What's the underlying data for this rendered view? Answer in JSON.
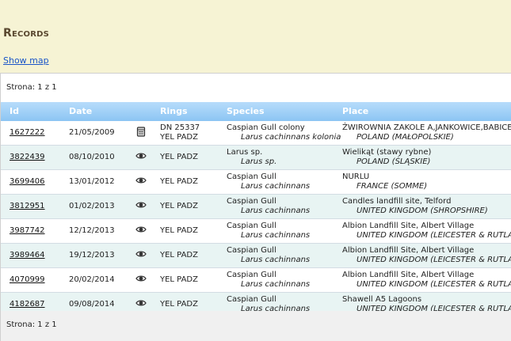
{
  "page": {
    "title": "Records",
    "show_map": "Show map",
    "pager_top": "Strona: 1 z 1",
    "pager_bottom": "Strona: 1 z 1"
  },
  "table": {
    "headers": {
      "id": "Id",
      "date": "Date",
      "rings": "Rings",
      "species": "Species",
      "place": "Place"
    },
    "rows": [
      {
        "id": "1627222",
        "date": "21/05/2009",
        "icon": "archive-icon",
        "ring1": "DN 25337",
        "ring2": "YEL PADZ",
        "species": "Caspian Gull colony",
        "species_latin": "Larus cachinnans kolonia",
        "place": "ŻWIROWNIA ZAKOLE A,JANKOWICE,BABICE",
        "region": "POLAND (MAŁOPOLSKIE)"
      },
      {
        "id": "3822439",
        "date": "08/10/2010",
        "icon": "eye-icon",
        "ring1": "YEL PADZ",
        "ring2": "",
        "species": "Larus sp.",
        "species_latin": "Larus sp.",
        "place": "Wielikąt (stawy rybne)",
        "region": "POLAND (ŚLĄSKIE)"
      },
      {
        "id": "3699406",
        "date": "13/01/2012",
        "icon": "eye-icon",
        "ring1": "YEL PADZ",
        "ring2": "",
        "species": "Caspian Gull",
        "species_latin": "Larus cachinnans",
        "place": "NURLU",
        "region": "FRANCE (SOMME)"
      },
      {
        "id": "3812951",
        "date": "01/02/2013",
        "icon": "eye-icon",
        "ring1": "YEL PADZ",
        "ring2": "",
        "species": "Caspian Gull",
        "species_latin": "Larus cachinnans",
        "place": "Candles landfill site, Telford",
        "region": "UNITED KINGDOM (SHROPSHIRE)"
      },
      {
        "id": "3987742",
        "date": "12/12/2013",
        "icon": "eye-icon",
        "ring1": "YEL PADZ",
        "ring2": "",
        "species": "Caspian Gull",
        "species_latin": "Larus cachinnans",
        "place": "Albion Landfill Site, Albert Village",
        "region": "UNITED KINGDOM (LEICESTER & RUTLAND)"
      },
      {
        "id": "3989464",
        "date": "19/12/2013",
        "icon": "eye-icon",
        "ring1": "YEL PADZ",
        "ring2": "",
        "species": "Caspian Gull",
        "species_latin": "Larus cachinnans",
        "place": "Albion Landfill Site, Albert Village",
        "region": "UNITED KINGDOM (LEICESTER & RUTLAND)"
      },
      {
        "id": "4070999",
        "date": "20/02/2014",
        "icon": "eye-icon",
        "ring1": "YEL PADZ",
        "ring2": "",
        "species": "Caspian Gull",
        "species_latin": "Larus cachinnans",
        "place": "Albion Landfill Site, Albert Village",
        "region": "UNITED KINGDOM (LEICESTER & RUTLAND)"
      },
      {
        "id": "4182687",
        "date": "09/08/2014",
        "icon": "eye-icon",
        "ring1": "YEL PADZ",
        "ring2": "",
        "species": "Caspian Gull",
        "species_latin": "Larus cachinnans",
        "place": "Shawell A5 Lagoons",
        "region": "UNITED KINGDOM (LEICESTER & RUTLAND)"
      }
    ]
  }
}
